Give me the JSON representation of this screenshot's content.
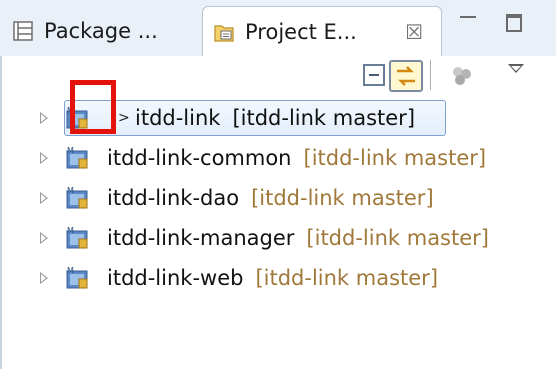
{
  "tabs": [
    {
      "label": "Package ...",
      "icon": "package-explorer-icon",
      "active": false
    },
    {
      "label": "Project E...",
      "icon": "project-explorer-icon",
      "active": true,
      "close_glyph": "☒"
    }
  ],
  "view_controls": {
    "minimize": "minimize-icon",
    "maximize": "maximize-icon"
  },
  "toolbar": {
    "items": [
      "collapse-all-icon",
      "link-with-editor-icon",
      "filters-icon",
      "view-menu-icon"
    ]
  },
  "tree": {
    "items": [
      {
        "name": "itdd-link",
        "repo": "[itdd-link master]",
        "selected": true
      },
      {
        "name": "itdd-link-common",
        "repo": "[itdd-link master]",
        "selected": false
      },
      {
        "name": "itdd-link-dao",
        "repo": "[itdd-link master]",
        "selected": false
      },
      {
        "name": "itdd-link-manager",
        "repo": "[itdd-link master]",
        "selected": false
      },
      {
        "name": "itdd-link-web",
        "repo": "[itdd-link master]",
        "selected": false
      }
    ]
  },
  "colors": {
    "highlight": "#e3120b",
    "repo_label": "#a0793a",
    "selection": "#e3eefc",
    "tabbar": "#eaf0f8"
  }
}
